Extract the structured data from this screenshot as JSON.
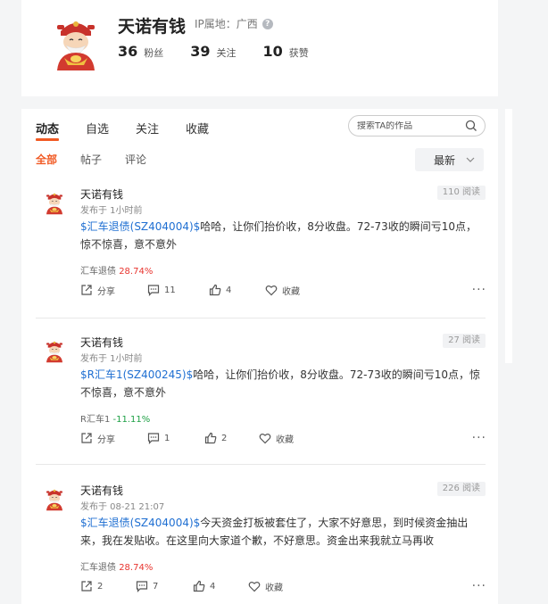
{
  "profile": {
    "name": "天诺有钱",
    "ip_location": "IP属地：广西",
    "stats": [
      {
        "num": "36",
        "label": "粉丝"
      },
      {
        "num": "39",
        "label": "关注"
      },
      {
        "num": "10",
        "label": "获赞"
      }
    ]
  },
  "tabs": [
    "动态",
    "自选",
    "关注",
    "收藏"
  ],
  "search": {
    "placeholder": "搜索TA的作品"
  },
  "subtabs": [
    "全部",
    "帖子",
    "评论"
  ],
  "sort": {
    "selected": "最新"
  },
  "posts": [
    {
      "author": "天诺有钱",
      "time": "发布于 1小时前",
      "views": "110 阅读",
      "stock": "$汇车退债(SZ404004)$",
      "text": "哈哈，让你们抬价收，8分收盘。72-73收的瞬间亏10点，惊不惊喜，意不意外",
      "tag_name": "汇车退债",
      "tag_change": "28.74%",
      "share": "分享",
      "comments": "11",
      "likes": "4",
      "fav": "收藏"
    },
    {
      "author": "天诺有钱",
      "time": "发布于 1小时前",
      "views": "27 阅读",
      "stock": "$R汇车1(SZ400245)$",
      "text": "哈哈，让你们抬价收，8分收盘。72-73收的瞬间亏10点，惊不惊喜，意不意外",
      "tag_name": "R汇车1",
      "tag_change": "-11.11%",
      "share": "分享",
      "comments": "1",
      "likes": "2",
      "fav": "收藏"
    },
    {
      "author": "天诺有钱",
      "time": "发布于 08-21 21:07",
      "views": "226 阅读",
      "stock": "$汇车退债(SZ404004)$",
      "text": "今天资金打板被套住了，大家不好意思，到时候资金抽出来，我在发贴收。在这里向大家道个歉，不好意思。资金出来我就立马再收",
      "tag_name": "汇车退债",
      "tag_change": "28.74%",
      "share": "2",
      "comments": "7",
      "likes": "4",
      "fav": "收藏"
    }
  ],
  "colors": {
    "accent": "#f15a24",
    "stock_link": "#1f6fd2",
    "up": "#e8352f",
    "down": "#1ea045"
  },
  "icons": [
    "help-icon",
    "search-icon",
    "share-icon",
    "comment-icon",
    "like-icon",
    "heart-icon",
    "more-icon",
    "chevron-down-icon"
  ]
}
